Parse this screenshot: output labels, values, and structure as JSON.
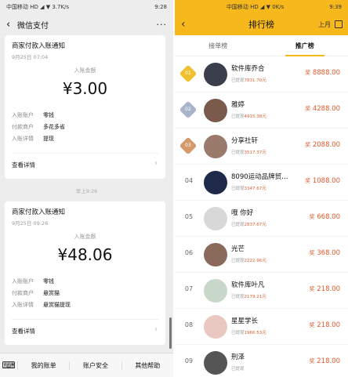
{
  "left": {
    "status": {
      "carrier": "中国移动 HD ◢ ▼ 3.7K/s",
      "time": "9:28"
    },
    "nav": {
      "back": "‹",
      "title": "微信支付",
      "more": "···"
    },
    "cards": [
      {
        "title": "商家付款入账通知",
        "date": "9月25日 07:04",
        "amount_label": "入账金额",
        "amount": "¥3.00",
        "rows": [
          {
            "k": "入账账户",
            "v": "零钱"
          },
          {
            "k": "付款商户",
            "v": "多花多省"
          },
          {
            "k": "入账详情",
            "v": "提现"
          }
        ],
        "link": "查看详情",
        "chevron": "›"
      },
      {
        "title": "商家付款入账通知",
        "date": "9月25日 09:26",
        "amount_label": "入账金额",
        "amount": "¥48.06",
        "rows": [
          {
            "k": "入账账户",
            "v": "零钱"
          },
          {
            "k": "付款商户",
            "v": "悬赏猫"
          },
          {
            "k": "入账详情",
            "v": "悬赏猫提现"
          }
        ],
        "link": "查看详情",
        "chevron": "›"
      }
    ],
    "time_separator": "早上9:26",
    "bottom": {
      "keyboard": "⌨",
      "menus": [
        "我的账单",
        "账户安全",
        "其他帮助"
      ]
    }
  },
  "right": {
    "status": {
      "carrier": "中国移动 HD ◢ ▼ 0K/s",
      "time": "9:39"
    },
    "nav": {
      "back": "‹",
      "title": "排行榜",
      "month": "上月"
    },
    "tabs": [
      "接单榜",
      "推广榜"
    ],
    "active_tab": 1,
    "accent": "#f7b81c",
    "prize_color": "#e2592b",
    "items": [
      {
        "rank": "01",
        "medal": "gold",
        "name": "软件库乔合",
        "sub_prefix": "已提现",
        "sub_num": "7831.70元",
        "prize_tag": "奖",
        "prize": "8888.00",
        "avatar": "#3a3f4b"
      },
      {
        "rank": "02",
        "medal": "silver",
        "name": "雅婷",
        "sub_prefix": "已提现",
        "sub_num": "4915.38元",
        "prize_tag": "奖",
        "prize": "4288.00",
        "avatar": "#7a5a4a"
      },
      {
        "rank": "03",
        "medal": "bronze",
        "name": "分享社轩",
        "sub_prefix": "已提现",
        "sub_num": "3517.37元",
        "prize_tag": "奖",
        "prize": "2088.00",
        "avatar": "#9a7a6a"
      },
      {
        "rank": "04",
        "medal": "",
        "name": "8090运动品牌贸…",
        "sub_prefix": "已提现",
        "sub_num": "3347.67元",
        "prize_tag": "奖",
        "prize": "1088.00",
        "avatar": "#1f2a4a"
      },
      {
        "rank": "05",
        "medal": "",
        "name": "哦 你好",
        "sub_prefix": "已提现",
        "sub_num": "2837.67元",
        "prize_tag": "奖",
        "prize": "668.00",
        "avatar": "#d8d8d8"
      },
      {
        "rank": "06",
        "medal": "",
        "name": "光芒",
        "sub_prefix": "已提现",
        "sub_num": "2222.96元",
        "prize_tag": "奖",
        "prize": "368.00",
        "avatar": "#8a6a5a"
      },
      {
        "rank": "07",
        "medal": "",
        "name": "软件库叶凡",
        "sub_prefix": "已提现",
        "sub_num": "2179.21元",
        "prize_tag": "奖",
        "prize": "218.00",
        "avatar": "#c8d8c8"
      },
      {
        "rank": "08",
        "medal": "",
        "name": "星星学长",
        "sub_prefix": "已提现",
        "sub_num": "1966.53元",
        "prize_tag": "奖",
        "prize": "218.00",
        "avatar": "#e8c8c0"
      },
      {
        "rank": "09",
        "medal": "",
        "name": "刑泽",
        "sub_prefix": "已提现",
        "sub_num": "",
        "prize_tag": "奖",
        "prize": "218.00",
        "avatar": "#555555"
      }
    ]
  }
}
